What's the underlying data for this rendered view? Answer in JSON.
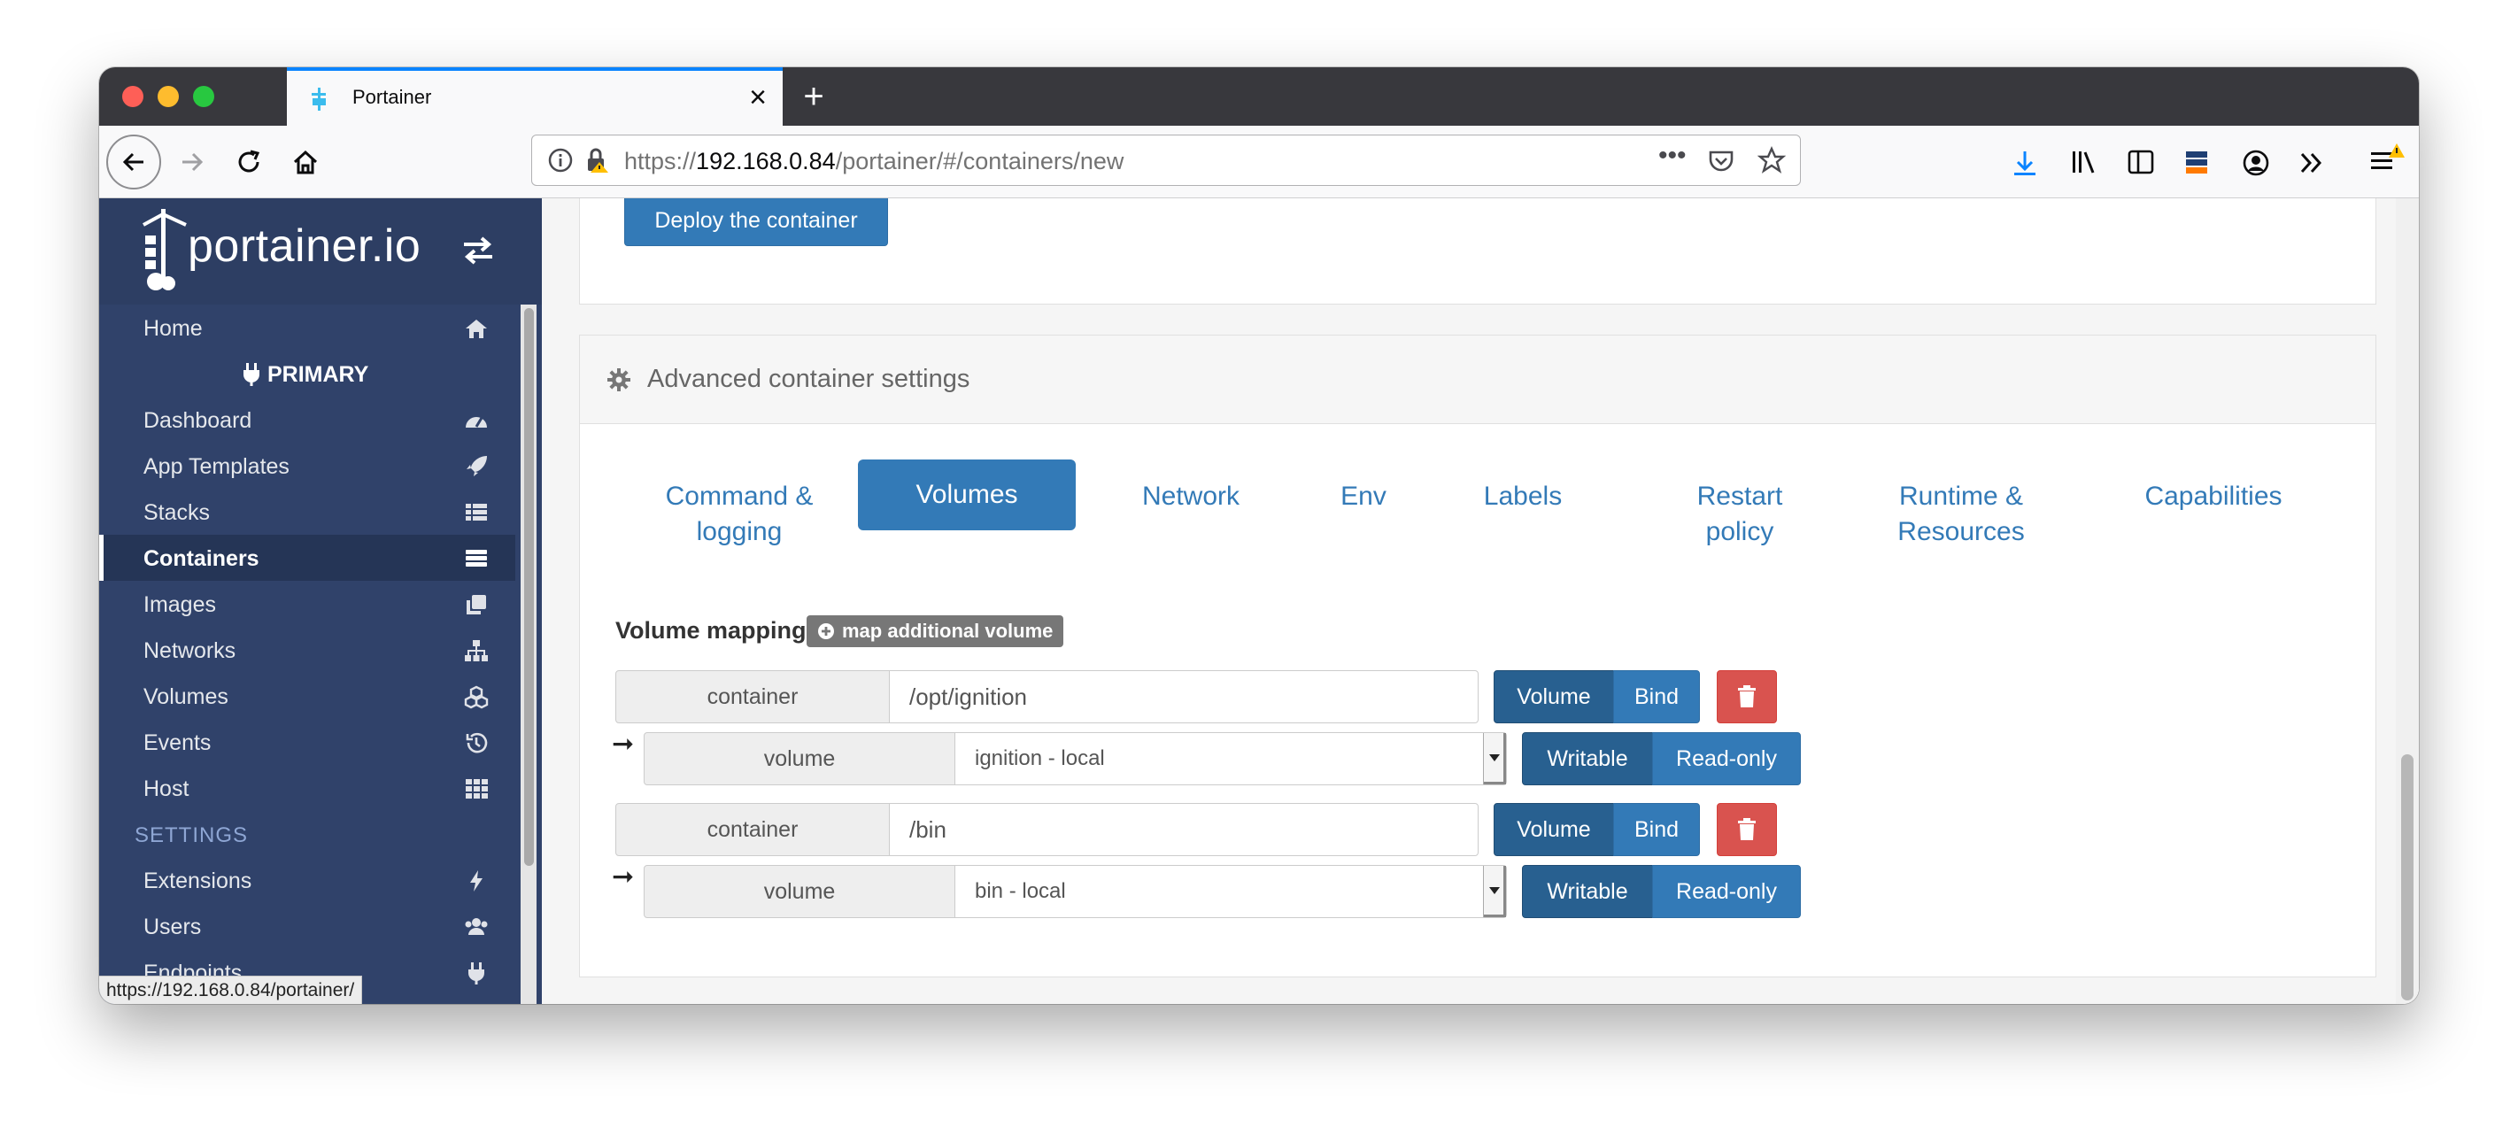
{
  "browser": {
    "tab_title": "Portainer",
    "url_prefix": "https://",
    "url_host": "192.168.0.84",
    "url_path": "/portainer/#/containers/new",
    "status_link": "https://192.168.0.84/portainer/"
  },
  "sidebar": {
    "brand": "portainer.io",
    "endpoint": "PRIMARY",
    "items": [
      {
        "label": "Home",
        "icon": "home-icon"
      },
      {
        "label": "Dashboard",
        "icon": "tachometer-icon"
      },
      {
        "label": "App Templates",
        "icon": "rocket-icon"
      },
      {
        "label": "Stacks",
        "icon": "th-list-icon"
      },
      {
        "label": "Containers",
        "icon": "server-icon",
        "active": true
      },
      {
        "label": "Images",
        "icon": "clone-icon"
      },
      {
        "label": "Networks",
        "icon": "sitemap-icon"
      },
      {
        "label": "Volumes",
        "icon": "cubes-icon"
      },
      {
        "label": "Events",
        "icon": "history-icon"
      },
      {
        "label": "Host",
        "icon": "th-icon"
      }
    ],
    "settings_heading": "SETTINGS",
    "settings_items": [
      {
        "label": "Extensions",
        "icon": "bolt-icon"
      },
      {
        "label": "Users",
        "icon": "users-icon"
      },
      {
        "label": "Endpoints",
        "icon": "plug-icon"
      }
    ]
  },
  "main": {
    "deploy_button": "Deploy the container",
    "advanced_title": "Advanced container settings",
    "tabs": [
      {
        "label_1": "Command &",
        "label_2": "logging"
      },
      {
        "label_1": "Volumes",
        "label_2": "",
        "active": true
      },
      {
        "label_1": "Network",
        "label_2": ""
      },
      {
        "label_1": "Env",
        "label_2": ""
      },
      {
        "label_1": "Labels",
        "label_2": ""
      },
      {
        "label_1": "Restart",
        "label_2": "policy"
      },
      {
        "label_1": "Runtime &",
        "label_2": "Resources"
      },
      {
        "label_1": "Capabilities",
        "label_2": ""
      }
    ],
    "volume_mapping_label": "Volume mapping",
    "map_additional_button": "map additional volume",
    "mappings": [
      {
        "container_label": "container",
        "container_path": "/opt/ignition",
        "type_volume": "Volume",
        "type_bind": "Bind",
        "volume_label": "volume",
        "volume_value": "ignition - local",
        "writable": "Writable",
        "read_only": "Read-only"
      },
      {
        "container_label": "container",
        "container_path": "/bin",
        "type_volume": "Volume",
        "type_bind": "Bind",
        "volume_label": "volume",
        "volume_value": "bin - local",
        "writable": "Writable",
        "read_only": "Read-only"
      }
    ]
  },
  "colors": {
    "sidebar_bg": "#30426a",
    "primary": "#337ab7",
    "primary_active": "#286090",
    "danger": "#d9534f"
  }
}
